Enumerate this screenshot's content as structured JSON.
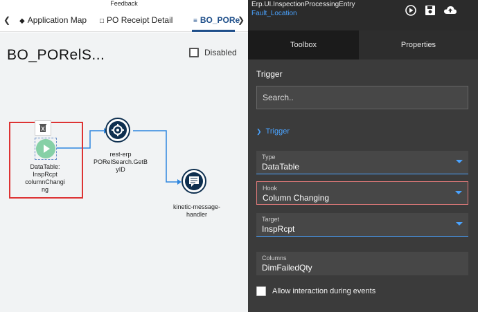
{
  "feedback": "Feedback",
  "tabs": [
    {
      "label": "Application Map",
      "icon": "layers-icon"
    },
    {
      "label": "PO Receipt Detail",
      "icon": "document-icon"
    },
    {
      "label": "BO_PORe",
      "icon": "workflow-icon"
    }
  ],
  "page": {
    "title": "BO_PORelS...",
    "disabled_label": "Disabled"
  },
  "nodes": {
    "trigger": "DataTable:\nInspRcpt\ncolumnChangi\nng",
    "rest": "rest-erp\nPORelSearch.GetB\nyID",
    "message": "kinetic-message-\nhandler"
  },
  "right": {
    "app_title": "Erp.UI.InspectionProcessingEntry",
    "app_link": "Fault_Location",
    "tabs": [
      "Toolbox",
      "Properties"
    ],
    "section": "Trigger",
    "search_placeholder": "Search..",
    "trigger_group": "Trigger",
    "fields": [
      {
        "label": "Type",
        "value": "DataTable"
      },
      {
        "label": "Hook",
        "value": "Column Changing"
      },
      {
        "label": "Target",
        "value": "InspRcpt"
      },
      {
        "label": "Columns",
        "value": "DimFailedQty"
      }
    ],
    "allow_label": "Allow interaction during events"
  },
  "colors": {
    "accent": "#4aa3ff",
    "dark_node": "#0e2f4f",
    "green_node": "#86d0a6",
    "highlight": "#dd3333"
  }
}
